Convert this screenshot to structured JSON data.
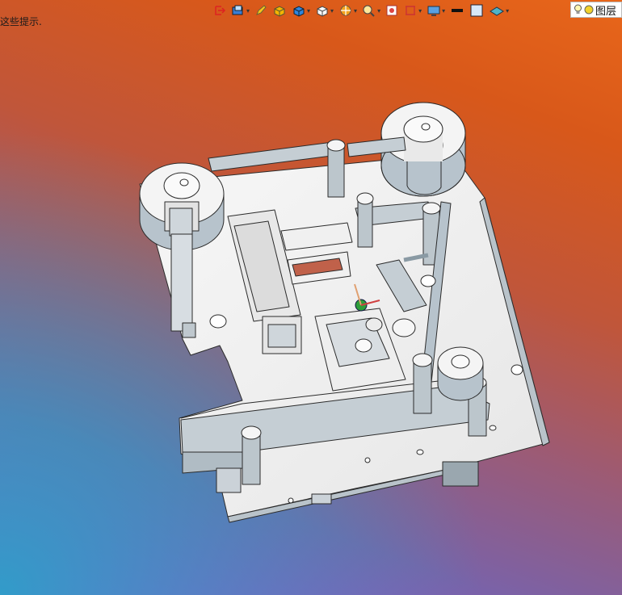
{
  "viewport": {
    "hint_text": "这些提示.",
    "background": {
      "top_color": "#e3621a",
      "bottom_left_color": "#2fa6c8",
      "bottom_right_color": "#a64fd2"
    }
  },
  "toolbar": {
    "buttons": [
      {
        "name": "exit-sketch-icon",
        "has_dropdown": false
      },
      {
        "name": "view-orient-icon",
        "has_dropdown": true
      },
      {
        "name": "pen-icon",
        "has_dropdown": false
      },
      {
        "name": "yellow-cube-icon",
        "has_dropdown": false
      },
      {
        "name": "blue-cube-icon",
        "has_dropdown": true
      },
      {
        "name": "white-cube-icon",
        "has_dropdown": true
      },
      {
        "name": "section-view-icon",
        "has_dropdown": true
      },
      {
        "name": "zoom-icon",
        "has_dropdown": true
      },
      {
        "name": "appearance-icon",
        "has_dropdown": false
      },
      {
        "name": "display-style-icon",
        "has_dropdown": true
      },
      {
        "name": "monitor-icon",
        "has_dropdown": true
      },
      {
        "name": "line-color-icon",
        "has_dropdown": false
      },
      {
        "name": "fill-color-icon",
        "has_dropdown": false
      },
      {
        "name": "scene-icon",
        "has_dropdown": true
      }
    ],
    "layer_label": "图层"
  },
  "model": {
    "part_color": "#eeeeee",
    "edge_color": "#2b2b2b",
    "shade_color": "#a9b6bf"
  }
}
